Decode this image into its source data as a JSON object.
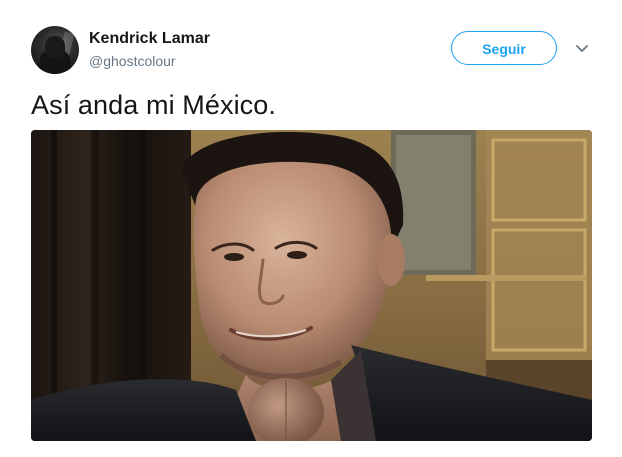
{
  "tweet": {
    "author": {
      "name": "Kendrick Lamar",
      "handle": "@ghostcolour"
    },
    "follow_label": "Seguir",
    "text": "Así anda mi México."
  },
  "colors": {
    "accent": "#1da1f2",
    "text": "#14171a",
    "secondary_text": "#657786"
  },
  "icons": {
    "menu": "chevron-down-icon"
  }
}
